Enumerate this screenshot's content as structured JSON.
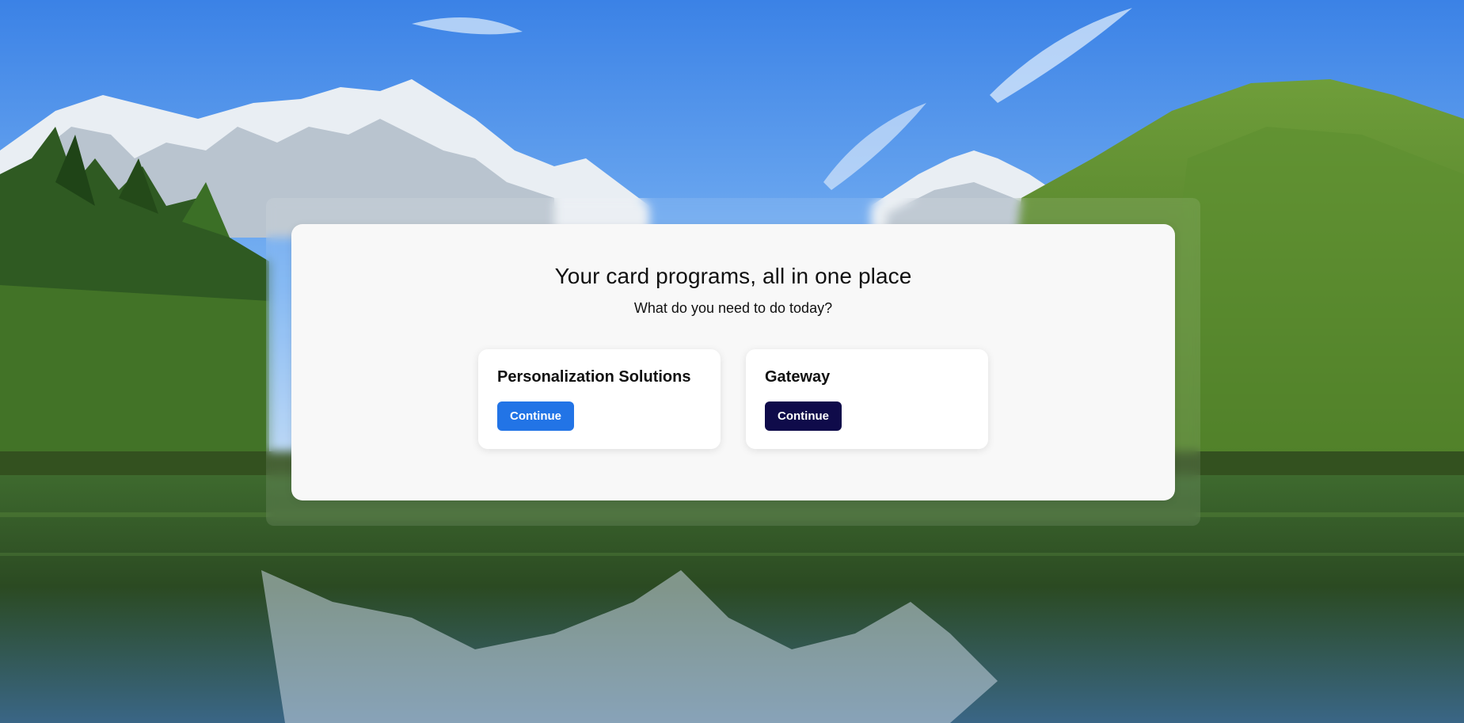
{
  "header": {
    "title": "Your card programs, all in one place",
    "subtitle": "What do you need to do today?"
  },
  "options": [
    {
      "title": "Personalization Solutions",
      "button_label": "Continue",
      "button_color": "#2274e6"
    },
    {
      "title": "Gateway",
      "button_label": "Continue",
      "button_color": "#0f0b4a"
    }
  ],
  "background": {
    "description_colors": {
      "sky": "#4f93ea",
      "snow": "#e8edf2",
      "forest": "#3f6a25",
      "water": "#2f4e2a"
    }
  }
}
